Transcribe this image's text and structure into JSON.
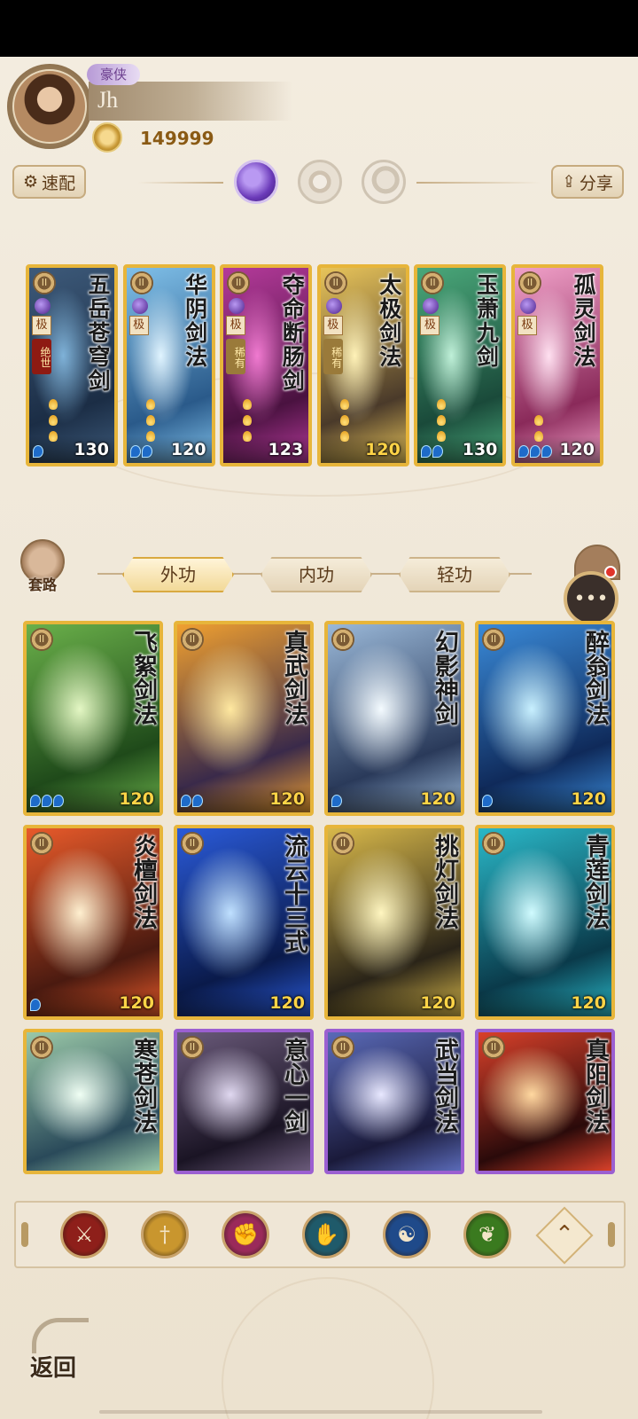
{
  "player": {
    "title_tag": "豪侠",
    "name": "Jh",
    "power": "149999"
  },
  "controls": {
    "quick_config_label": "速配",
    "share_label": "分享",
    "orbs": [
      "moon-orb",
      "sun-orb",
      "eclipse-orb"
    ]
  },
  "equipped_cards": [
    {
      "name": "五岳苍穹剑",
      "level": "130",
      "grade": "极",
      "rank": "绝世",
      "rank_type": "legend",
      "level_gold": false,
      "pips": 1,
      "flames": 3,
      "art": [
        "#3d5a7a",
        "#1b2d45",
        "#7fb2d8"
      ]
    },
    {
      "name": "华阴剑法",
      "level": "120",
      "grade": "极",
      "rank": "",
      "rank_type": "",
      "level_gold": false,
      "pips": 2,
      "flames": 3,
      "art": [
        "#7fbfe8",
        "#2a5a8a",
        "#e0f4ff"
      ]
    },
    {
      "name": "夺命断肠剑",
      "level": "123",
      "grade": "极",
      "rank": "稀有",
      "rank_type": "rare",
      "level_gold": false,
      "pips": 0,
      "flames": 3,
      "art": [
        "#b43a9a",
        "#4a1240",
        "#f07ad0"
      ]
    },
    {
      "name": "太极剑法",
      "level": "120",
      "grade": "极",
      "rank": "稀有",
      "rank_type": "rare",
      "level_gold": true,
      "pips": 0,
      "flames": 3,
      "art": [
        "#e8c45a",
        "#4a3a2a",
        "#fff2b8"
      ]
    },
    {
      "name": "玉萧九剑",
      "level": "130",
      "grade": "极",
      "rank": "",
      "rank_type": "",
      "level_gold": false,
      "pips": 2,
      "flames": 3,
      "art": [
        "#4aa87a",
        "#1a4a3a",
        "#bff0d8"
      ]
    },
    {
      "name": "孤灵剑法",
      "level": "120",
      "grade": "极",
      "rank": "",
      "rank_type": "",
      "level_gold": false,
      "pips": 3,
      "flames": 2,
      "art": [
        "#f0a0c8",
        "#8a2a5a",
        "#ffe0f0"
      ]
    }
  ],
  "tabs": [
    {
      "label": "外功",
      "active": true
    },
    {
      "label": "内功",
      "active": false
    },
    {
      "label": "轻功",
      "active": false
    }
  ],
  "routine_label": "套路",
  "library_cards": [
    {
      "name": "飞絮剑法",
      "level": "120",
      "pips": 3,
      "border": "gold",
      "art": [
        "#6ab04a",
        "#1f4a1a",
        "#e4f7c4"
      ]
    },
    {
      "name": "真武剑法",
      "level": "120",
      "pips": 2,
      "border": "gold",
      "art": [
        "#f0a030",
        "#3a2a4a",
        "#ffe8a0"
      ]
    },
    {
      "name": "幻影神剑",
      "level": "120",
      "pips": 1,
      "border": "gold",
      "art": [
        "#9ab8d8",
        "#2a3a5a",
        "#f4fbff"
      ]
    },
    {
      "name": "醉翁剑法",
      "level": "120",
      "pips": 1,
      "border": "gold",
      "art": [
        "#3a8ad8",
        "#0f2a5a",
        "#c8f0ff"
      ]
    },
    {
      "name": "炎檀剑法",
      "level": "120",
      "pips": 1,
      "border": "gold",
      "art": [
        "#e85a2a",
        "#4a1a10",
        "#fff0d0"
      ]
    },
    {
      "name": "流云十三式",
      "level": "120",
      "pips": 0,
      "border": "gold",
      "art": [
        "#2a5ad8",
        "#0a1a4a",
        "#bfe0ff"
      ]
    },
    {
      "name": "挑灯剑法",
      "level": "120",
      "pips": 0,
      "border": "gold",
      "art": [
        "#d8b84a",
        "#2a2418",
        "#fff6c0"
      ]
    },
    {
      "name": "青莲剑法",
      "level": "120",
      "pips": 0,
      "border": "gold",
      "art": [
        "#2ab8c8",
        "#0a3a4a",
        "#d0fbff"
      ]
    },
    {
      "name": "寒苍剑法",
      "level": "",
      "pips": 0,
      "border": "gold",
      "art": [
        "#9ac8a8",
        "#2a4a5a",
        "#f0fff4"
      ]
    },
    {
      "name": "意心一剑",
      "level": "",
      "pips": 0,
      "border": "purple",
      "art": [
        "#6a5a7a",
        "#1a1424",
        "#e0d8f0"
      ]
    },
    {
      "name": "武当剑法",
      "level": "",
      "pips": 0,
      "border": "purple",
      "art": [
        "#5a6ab8",
        "#1a1a3a",
        "#e8e8ff"
      ]
    },
    {
      "name": "真阳剑法",
      "level": "",
      "pips": 0,
      "border": "purple",
      "art": [
        "#d8402a",
        "#2a0a0a",
        "#ffd8a0"
      ]
    }
  ],
  "filters": [
    {
      "name": "sword-school-icon",
      "color": "#8e1f1a",
      "glyph": "⚔"
    },
    {
      "name": "blade-school-icon",
      "color": "#c9962e",
      "glyph": "†"
    },
    {
      "name": "fist-school-icon",
      "color": "#9a2a5a",
      "glyph": "✊"
    },
    {
      "name": "palm-school-icon",
      "color": "#1f5a6a",
      "glyph": "✋"
    },
    {
      "name": "taiji-school-icon",
      "color": "#1f4a8a",
      "glyph": "☯"
    },
    {
      "name": "staff-school-icon",
      "color": "#3a7a1f",
      "glyph": "❦"
    }
  ],
  "back_label": "返回"
}
